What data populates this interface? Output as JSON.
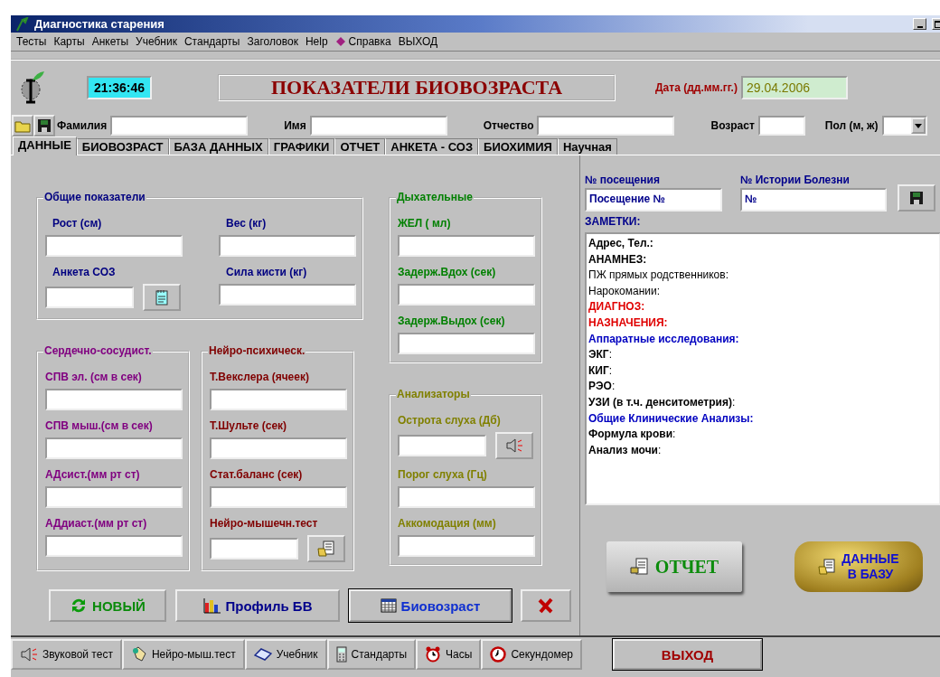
{
  "window": {
    "title": "Диагностика старения"
  },
  "menu": [
    {
      "label": "Тесты",
      "has_icon": false
    },
    {
      "label": "Карты",
      "has_icon": false
    },
    {
      "label": "Анкеты",
      "has_icon": false
    },
    {
      "label": "Учебник",
      "has_icon": false
    },
    {
      "label": "Стандарты",
      "has_icon": false
    },
    {
      "label": "Заголовок",
      "has_icon": false
    },
    {
      "label": "Help",
      "has_icon": false
    },
    {
      "label": "Справка",
      "has_icon": true
    },
    {
      "label": "ВЫХОД",
      "has_icon": false
    }
  ],
  "header": {
    "clock": "21:36:46",
    "title": "ПОКАЗАТЕЛИ БИОВОЗРАСТА",
    "date_label": "Дата (дд.мм.гг.)",
    "date": "29.04.2006"
  },
  "person": {
    "fields": [
      {
        "label": "Фамилия",
        "kind": "wide"
      },
      {
        "label": "Имя",
        "kind": "wide"
      },
      {
        "label": "Отчество",
        "kind": "wide"
      },
      {
        "label": "Возраст",
        "kind": "narrow"
      }
    ],
    "sex_label": "Пол (м, ж)"
  },
  "tabs": [
    {
      "label": "ДАННЫЕ",
      "selected": true
    },
    {
      "label": "БИОВОЗРАСТ",
      "selected": false
    },
    {
      "label": "БАЗА ДАННЫХ",
      "selected": false
    },
    {
      "label": "ГРАФИКИ",
      "selected": false
    },
    {
      "label": "ОТЧЕТ",
      "selected": false
    },
    {
      "label": "АНКЕТА - СОЗ",
      "selected": false
    },
    {
      "label": "БИОХИМИЯ",
      "selected": false
    },
    {
      "label": "Научная",
      "selected": false
    }
  ],
  "left": {
    "top": {
      "title": "Общие показатели",
      "color": "#000080",
      "kind": "grid",
      "fields": [
        {
          "label": "Рост (см)",
          "kind": "plain"
        },
        {
          "label": "Вес (кг)",
          "kind": "plain"
        },
        {
          "label": "Анкета СОЗ",
          "kind": "notepad"
        },
        {
          "label": "Сила кисти (кг)",
          "kind": "plain"
        }
      ]
    },
    "bottom": [
      {
        "title": "Сердечно-сосудист.",
        "color": "#800080",
        "kind": "stack",
        "fields": [
          {
            "label": "СПВ эл. (см в сек)",
            "kind": "plain"
          },
          {
            "label": "СПВ мыш.(см в сек)",
            "kind": "plain"
          },
          {
            "label": "АДсист.(мм рт ст)",
            "kind": "plain"
          },
          {
            "label": "АДдиаст.(мм рт ст)",
            "kind": "plain"
          }
        ]
      },
      {
        "title": "Нейро-психическ.",
        "color": "#800000",
        "kind": "stack",
        "fields": [
          {
            "label": "Т.Векслера (ячеек)",
            "kind": "plain"
          },
          {
            "label": "Т.Шульте (сек)",
            "kind": "plain"
          },
          {
            "label": "Стат.баланс (сек)",
            "kind": "plain"
          },
          {
            "label": "Нейро-мышечн.тест",
            "kind": "folder"
          }
        ]
      }
    ]
  },
  "right": [
    {
      "title": "Дыхательные",
      "color": "#008000",
      "kind": "stack",
      "fields": [
        {
          "label": "ЖЕЛ ( мл)",
          "kind": "plain"
        },
        {
          "label": "Задерж.Вдох (сек)",
          "kind": "plain"
        },
        {
          "label": "Задерж.Выдох (сек)",
          "kind": "plain"
        }
      ]
    },
    {
      "title": "Анализаторы",
      "color": "#808000",
      "kind": "stack",
      "fields": [
        {
          "label": "Острота слуха (Дб)",
          "kind": "speaker"
        },
        {
          "label": "Порог слуха (Гц)",
          "kind": "plain"
        },
        {
          "label": "Аккомодация (мм)",
          "kind": "plain"
        }
      ]
    }
  ],
  "visit": {
    "visit_label": "№ посещения",
    "visit_value": "Посещение №",
    "history_label": "№ Истории Болезни",
    "history_value": "№"
  },
  "notes": {
    "label": "ЗАМЕТКИ:",
    "lines": [
      {
        "text": "Адрес, Тел.:",
        "color": "#000000",
        "bold": true
      },
      {
        "text": "АНАМНЕЗ:",
        "color": "#000000",
        "bold": true
      },
      {
        "text": "ПЖ прямых родственников:",
        "color": "#000000",
        "bold": false
      },
      {
        "text": "Нарокомании:",
        "color": "#000000",
        "bold": false
      },
      {
        "text": "ДИАГНОЗ:",
        "color": "#e00000",
        "bold": true
      },
      {
        "text": "НАЗНАЧЕНИЯ:",
        "color": "#e00000",
        "bold": true
      },
      {
        "text": "Аппаратные исследования:",
        "color": "#0000c0",
        "bold": true
      },
      {
        "text": "**ЭКГ**:",
        "color": "#000000",
        "bold": false
      },
      {
        "text": "**КИГ**:",
        "color": "#000000",
        "bold": false
      },
      {
        "text": "**РЭО**:",
        "color": "#000000",
        "bold": false
      },
      {
        "text": "**УЗИ (в т.ч. денситометрия)**:",
        "color": "#000000",
        "bold": false
      },
      {
        "text": "Общие Клинические Анализы:",
        "color": "#0000c0",
        "bold": true
      },
      {
        "text": "**Формула крови**:",
        "color": "#000000",
        "bold": false
      },
      {
        "text": "**Анализ мочи**:",
        "color": "#000000",
        "bold": false
      }
    ]
  },
  "actions": [
    {
      "kind": "new",
      "label": "НОВЫЙ",
      "default": false
    },
    {
      "kind": "profile",
      "label": "Профиль БВ",
      "default": false
    },
    {
      "kind": "bioage",
      "label": "Биовозраст",
      "default": true
    },
    {
      "kind": "delete",
      "default": false
    }
  ],
  "report_button": "ОТЧЕТ",
  "db_button": {
    "lines": [
      "ДАННЫЕ",
      "В БАЗУ"
    ]
  },
  "toolbar": [
    {
      "kind": "sound",
      "label": "Звуковой тест"
    },
    {
      "kind": "hand",
      "label": "Нейро-мыш.тест"
    },
    {
      "kind": "book",
      "label": "Учебник"
    },
    {
      "kind": "calculator",
      "label": "Стандарты"
    },
    {
      "kind": "alarm",
      "label": "Часы"
    },
    {
      "kind": "stopwatch",
      "label": "Секундомер"
    }
  ],
  "exit_button": "ВЫХОД"
}
